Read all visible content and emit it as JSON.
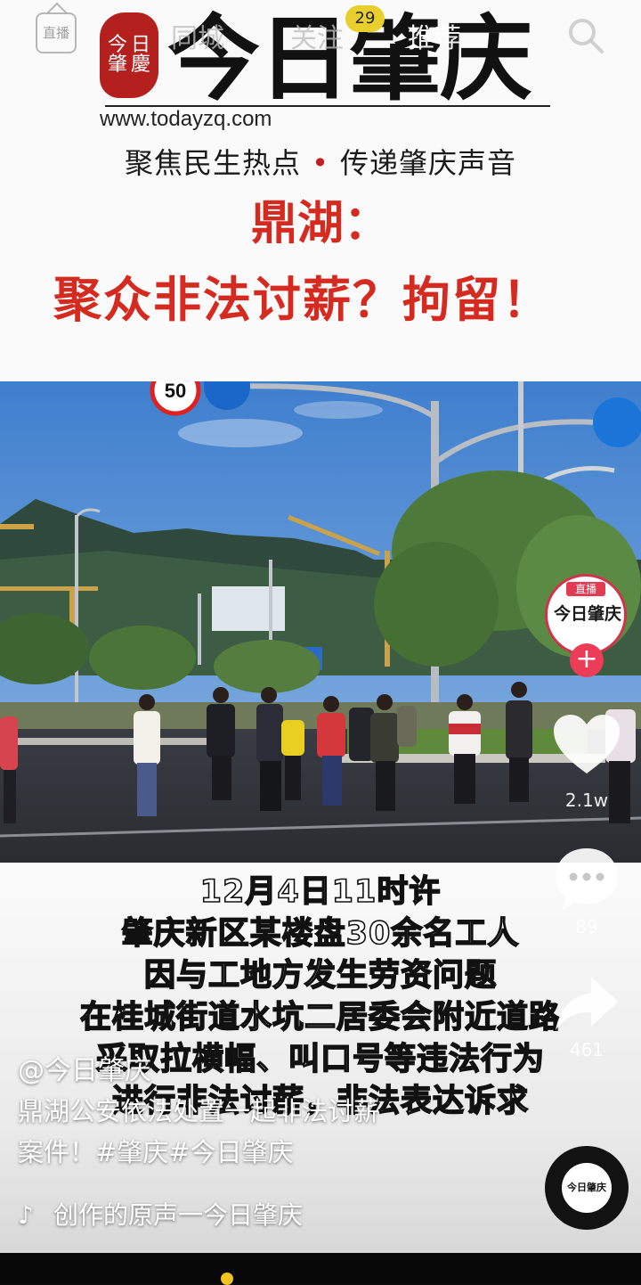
{
  "top_nav": {
    "live_label": "直播",
    "tabs": [
      {
        "label": "同城"
      },
      {
        "label": "关注",
        "badge": "29"
      },
      {
        "label": "推荐"
      }
    ]
  },
  "banner": {
    "seal_text": [
      "今",
      "日",
      "肇",
      "慶"
    ],
    "logo_title": "今日肇庆",
    "logo_url": "www.todayzq.com",
    "slogan_left": "聚焦民生热点",
    "slogan_dot": "•",
    "slogan_right": "传递肇庆声音",
    "headline_line1": "鼎湖：",
    "headline_line2": "聚众非法讨薪？拘留！"
  },
  "photo": {
    "speed_sign": "50"
  },
  "caption_lines": [
    "12月4日11时许",
    "肇庆新区某楼盘30余名工人",
    "因与工地方发生劳资问题",
    "在桂城街道水坑二居委会附近道路",
    "采取拉横幅、叫口号等违法行为",
    "进行非法讨薪，非法表达诉求"
  ],
  "actions": {
    "avatar_live_label": "直播",
    "avatar_name": "今日肇庆",
    "follow_symbol": "+",
    "like_count": "2.1w",
    "comment_count": "89",
    "share_count": "461"
  },
  "post": {
    "author": "@今日肇庆",
    "description_line1": "鼎湖公安依法处置一起非法讨薪",
    "description_line2": "案件！#肇庆#今日肇庆",
    "music": "创作的原声一今日肇庆",
    "disc_label": "今日肇庆"
  },
  "icons": [
    "live-icon",
    "search-icon",
    "heart-icon",
    "comment-icon",
    "share-icon",
    "music-note-icon",
    "music-disc-icon"
  ],
  "colors": {
    "headline_red": "#d42a20",
    "badge_yellow": "#e9cf2e",
    "like_pink": "#ec3c57"
  }
}
